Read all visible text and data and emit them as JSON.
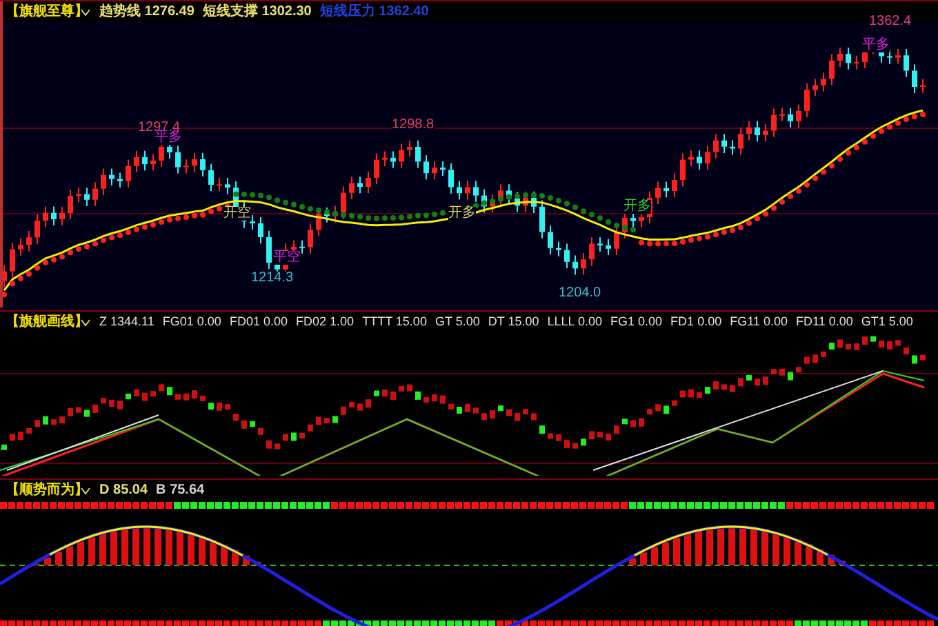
{
  "panels": [
    {
      "title": "【旗舰至尊】",
      "items": [
        {
          "label": "趋势线",
          "value": "1276.49",
          "color": "#e8e070"
        },
        {
          "label": "短线支撑",
          "value": "1302.30",
          "color": "#e8e070"
        },
        {
          "label": "短线压力",
          "value": "1362.40",
          "color": "#2040e0"
        }
      ],
      "labels": [
        {
          "text": "1297.4",
          "color": "#e04060"
        },
        {
          "text": "平多",
          "color": "#e020e0"
        },
        {
          "text": "1298.8",
          "color": "#e04060"
        },
        {
          "text": "开空",
          "color": "#e0d060"
        },
        {
          "text": "平空",
          "color": "#e020e0"
        },
        {
          "text": "1214.3",
          "color": "#30c0d0"
        },
        {
          "text": "开多",
          "color": "#e0d060"
        },
        {
          "text": "1204.0",
          "color": "#30c0d0"
        },
        {
          "text": "开多",
          "color": "#30d030"
        },
        {
          "text": "1362.4",
          "color": "#e04060"
        },
        {
          "text": "平多",
          "color": "#e020e0"
        }
      ]
    },
    {
      "title": "【旗舰画线】",
      "items": [
        {
          "label": "Z",
          "value": "1344.11"
        },
        {
          "label": "FG01",
          "value": "0.00"
        },
        {
          "label": "FD01",
          "value": "0.00"
        },
        {
          "label": "FD02",
          "value": "1.00"
        },
        {
          "label": "TTTT",
          "value": "15.00"
        },
        {
          "label": "GT",
          "value": "5.00"
        },
        {
          "label": "DT",
          "value": "15.00"
        },
        {
          "label": "LLLL",
          "value": "0.00"
        },
        {
          "label": "FG1",
          "value": "0.00"
        },
        {
          "label": "FD1",
          "value": "0.00"
        },
        {
          "label": "FG11",
          "value": "0.00"
        },
        {
          "label": "FD11",
          "value": "0.00"
        },
        {
          "label": "GT1",
          "value": "5.00"
        }
      ]
    },
    {
      "title": "【顺势而为】",
      "items": [
        {
          "label": "D",
          "value": "85.04",
          "color": "#e8e070"
        },
        {
          "label": "B",
          "value": "75.64",
          "color": "#d0d0d0"
        }
      ]
    }
  ]
}
